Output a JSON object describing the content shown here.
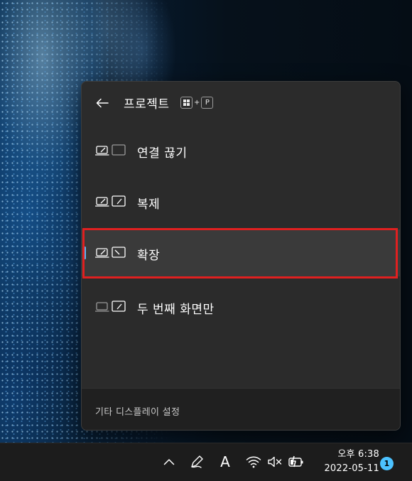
{
  "flyout": {
    "title": "프로젝트",
    "shortcut": {
      "key1_icon": "windows-logo-icon",
      "plus": "+",
      "key2": "P"
    },
    "options": [
      {
        "label": "연결 끊기",
        "icon": "pc-screen-only-icon",
        "selected": false
      },
      {
        "label": "복제",
        "icon": "duplicate-icon",
        "selected": false
      },
      {
        "label": "확장",
        "icon": "extend-icon",
        "selected": true
      },
      {
        "label": "두 번째 화면만",
        "icon": "second-screen-only-icon",
        "selected": false
      }
    ],
    "footer_link": "기타 디스플레이 설정"
  },
  "taskbar": {
    "icons": [
      "chevron-up-icon",
      "pen-icon",
      "input-indicator-A-icon",
      "wifi-icon",
      "volume-muted-icon",
      "battery-charging-icon"
    ],
    "input_indicator": "A",
    "time": "오후 6:38",
    "date": "2022-05-11",
    "notification_count": "1"
  },
  "colors": {
    "flyout_bg": "#2b2b2b",
    "selected_bg": "#3a3a3a",
    "accent": "#60b4f0",
    "highlight_border": "#e02020",
    "taskbar_bg": "#1c1c1c",
    "badge": "#4cc2ff"
  }
}
